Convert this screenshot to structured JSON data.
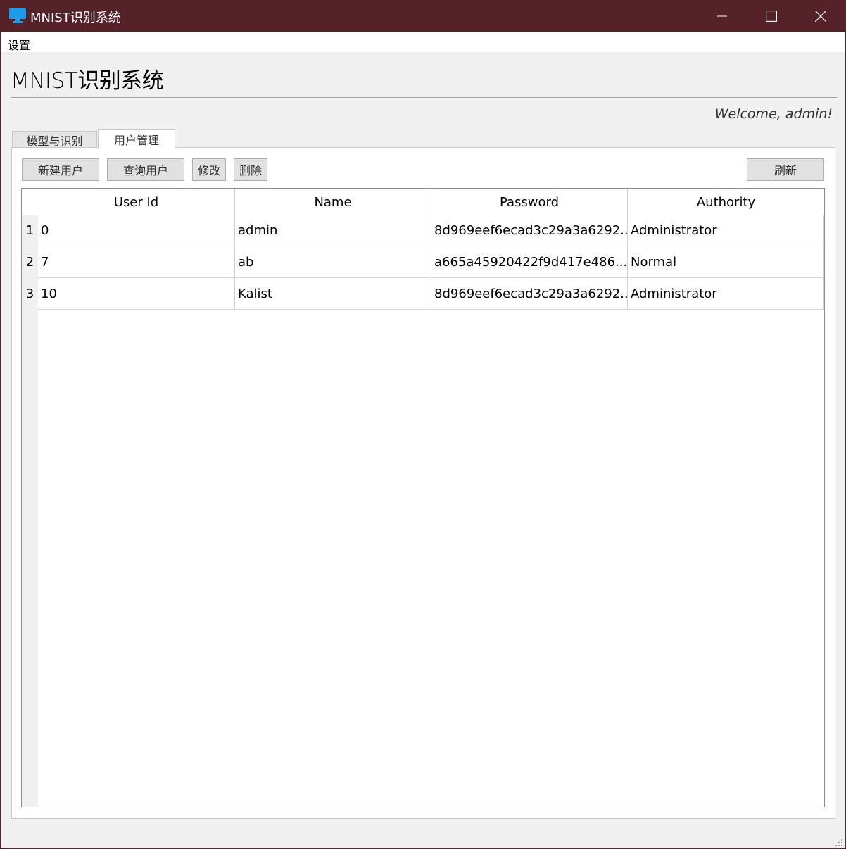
{
  "window": {
    "title": "MNIST识别系统",
    "icon": "monitor-icon",
    "accent": "#55222a"
  },
  "menu": {
    "items": [
      {
        "label": "设置"
      }
    ]
  },
  "header": {
    "title": "MNIST识别系统",
    "welcome": "Welcome, admin!"
  },
  "tabs": [
    {
      "label": "模型与识别",
      "active": false
    },
    {
      "label": "用户管理",
      "active": true
    }
  ],
  "toolbar": {
    "new_user": "新建用户",
    "query_user": "查询用户",
    "modify": "修改",
    "delete": "删除",
    "refresh": "刷新"
  },
  "table": {
    "columns": [
      "User Id",
      "Name",
      "Password",
      "Authority"
    ],
    "rows": [
      {
        "num": "1",
        "cells": [
          "0",
          "admin",
          "8d969eef6ecad3c29a3a6292...",
          "Administrator"
        ]
      },
      {
        "num": "2",
        "cells": [
          "7",
          "ab",
          "a665a45920422f9d417e486...",
          "Normal"
        ]
      },
      {
        "num": "3",
        "cells": [
          "10",
          "Kalist",
          "8d969eef6ecad3c29a3a6292...",
          "Administrator"
        ]
      }
    ]
  }
}
